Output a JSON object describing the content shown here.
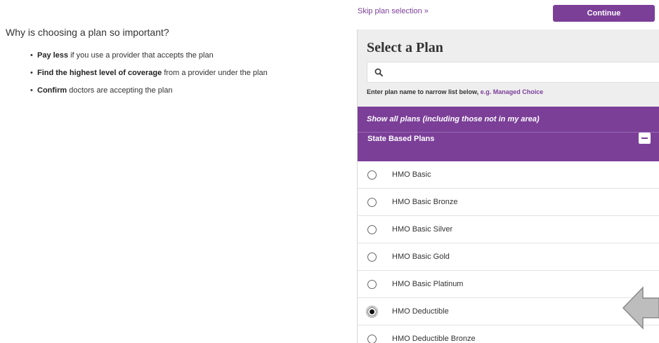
{
  "info": {
    "heading": "Why is choosing a plan so important?",
    "bullets": [
      {
        "bold": "Pay less",
        "rest": " if you use a provider that accepts the plan"
      },
      {
        "bold": "Find the highest level of coverage",
        "rest": " from a provider under the plan"
      },
      {
        "bold": "Confirm",
        "rest": " doctors are accepting the plan"
      }
    ]
  },
  "top": {
    "skip_label": "Skip plan selection »",
    "continue_label": "Continue"
  },
  "panel": {
    "title": "Select a Plan",
    "search_placeholder": "",
    "hint_prefix": "Enter plan name to narrow list below, ",
    "hint_example": "e.g. Managed Choice",
    "show_all_label": "Show all plans (including those not in my area)",
    "group_label": "State Based Plans"
  },
  "plans": [
    {
      "name": "HMO Basic",
      "selected": false
    },
    {
      "name": "HMO Basic Bronze",
      "selected": false
    },
    {
      "name": "HMO Basic Silver",
      "selected": false
    },
    {
      "name": "HMO Basic Gold",
      "selected": false
    },
    {
      "name": "HMO Basic Platinum",
      "selected": false
    },
    {
      "name": "HMO Deductible",
      "selected": true
    },
    {
      "name": "HMO Deductible Bronze",
      "selected": false
    }
  ],
  "colors": {
    "brand_purple": "#7b3f98",
    "panel_bg": "#eeeeee"
  }
}
